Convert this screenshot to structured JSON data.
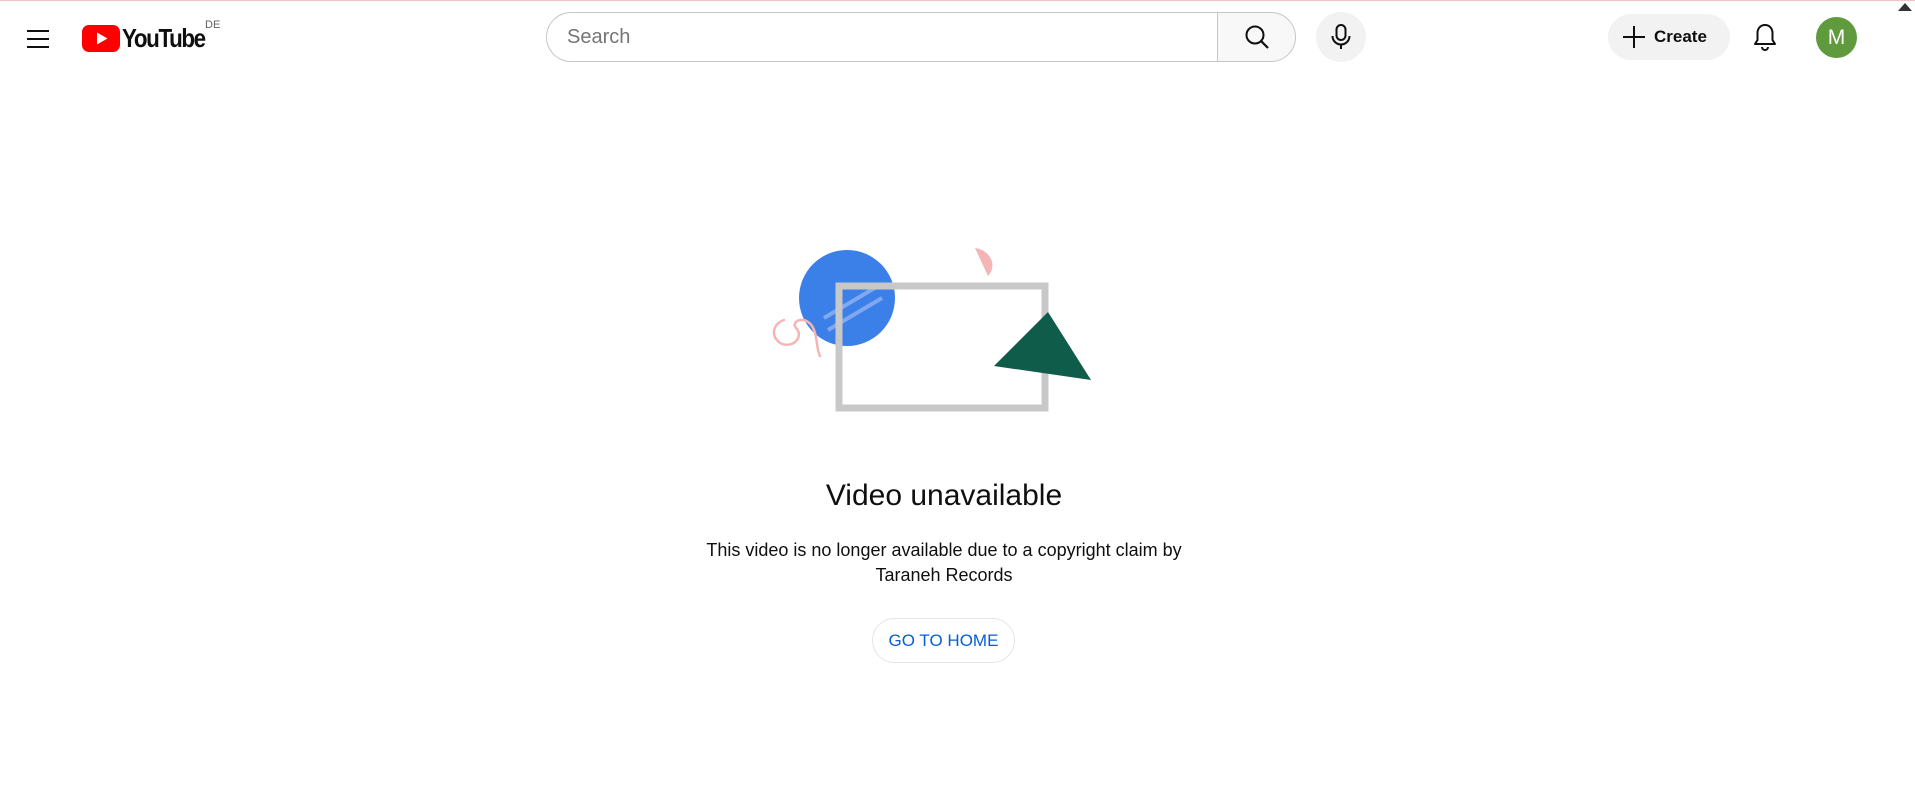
{
  "masthead": {
    "logo_text": "YouTube",
    "country_code": "DE",
    "search_placeholder": "Search",
    "create_label": "Create",
    "avatar_initial": "M"
  },
  "error": {
    "title": "Video unavailable",
    "message": "This video is no longer available due to a copyright claim by Taraneh Records",
    "button_label": "GO TO HOME"
  },
  "colors": {
    "brand_red": "#ff0000",
    "link_blue": "#065fd4",
    "avatar_green": "#5f9a3c"
  },
  "icons": [
    "hamburger-menu-icon",
    "youtube-play-icon",
    "search-icon",
    "microphone-icon",
    "plus-icon",
    "bell-icon"
  ]
}
